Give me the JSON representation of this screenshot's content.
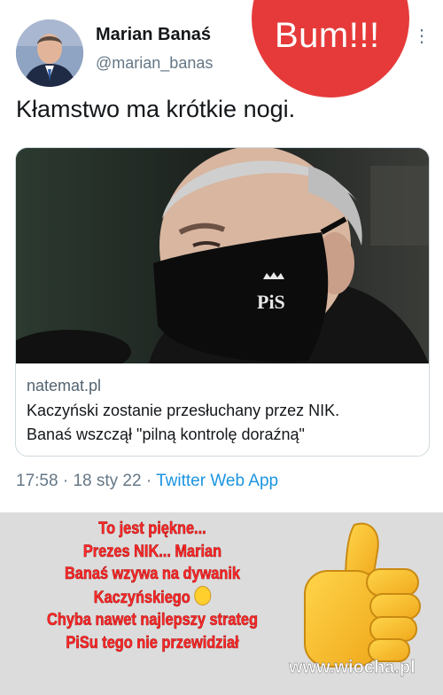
{
  "author": {
    "name": "Marian Banaś",
    "handle": "@marian_banas"
  },
  "overlay_label": "Bum!!!",
  "tweet_text": "Kłamstwo ma krótkie nogi.",
  "link_card": {
    "domain": "natemat.pl",
    "title_line1": "Kaczyński zostanie przesłuchany przez NIK.",
    "title_line2": "Banaś wszczął \"pilną kontrolę doraźną\"",
    "mask_logo": "PiS"
  },
  "meta": {
    "time": "17:58",
    "date": "18 sty 22",
    "separator": "·",
    "source": "Twitter Web App"
  },
  "caption_lines": [
    "To jest piękne...",
    "Prezes NIK... Marian",
    "Banaś wzywa na dywanik",
    "Kaczyńskiego",
    "Chyba nawet najlepszy strateg",
    "PiSu tego nie przewidział"
  ],
  "watermark": "www.wiocha.pl",
  "icons": {
    "more": "more-vertical-icon",
    "laughing_emoji": "rofl-emoji-icon",
    "thumbs_up": "thumbs-up-icon"
  },
  "colors": {
    "overlay_red": "#e63a3a",
    "link_blue": "#1b95e0",
    "caption_red": "#ff2a2a"
  }
}
